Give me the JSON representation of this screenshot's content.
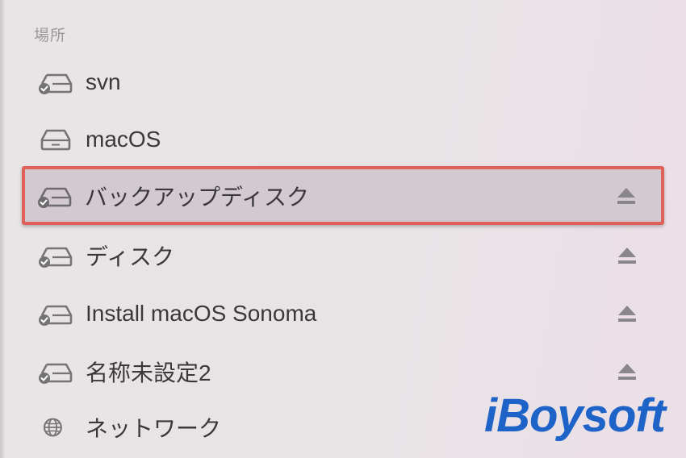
{
  "sidebar": {
    "section_header": "場所",
    "items": [
      {
        "label": "svn",
        "icon": "external-drive-icon",
        "ejectable": false,
        "selected": false
      },
      {
        "label": "macOS",
        "icon": "internal-drive-icon",
        "ejectable": false,
        "selected": false
      },
      {
        "label": "バックアップディスク",
        "icon": "external-drive-icon",
        "ejectable": true,
        "selected": true
      },
      {
        "label": "ディスク",
        "icon": "external-drive-icon",
        "ejectable": true,
        "selected": false
      },
      {
        "label": "Install macOS Sonoma",
        "icon": "external-drive-icon",
        "ejectable": true,
        "selected": false
      },
      {
        "label": "名称未設定2",
        "icon": "external-drive-icon",
        "ejectable": true,
        "selected": false
      },
      {
        "label": "ネットワーク",
        "icon": "globe-icon",
        "ejectable": false,
        "selected": false
      }
    ]
  },
  "watermark": "iBoysoft",
  "colors": {
    "highlight_border": "#e0605a",
    "selected_background": "#d3c9d1",
    "watermark": "#1e63c8",
    "text": "#3a383a",
    "icon": "#767376"
  }
}
